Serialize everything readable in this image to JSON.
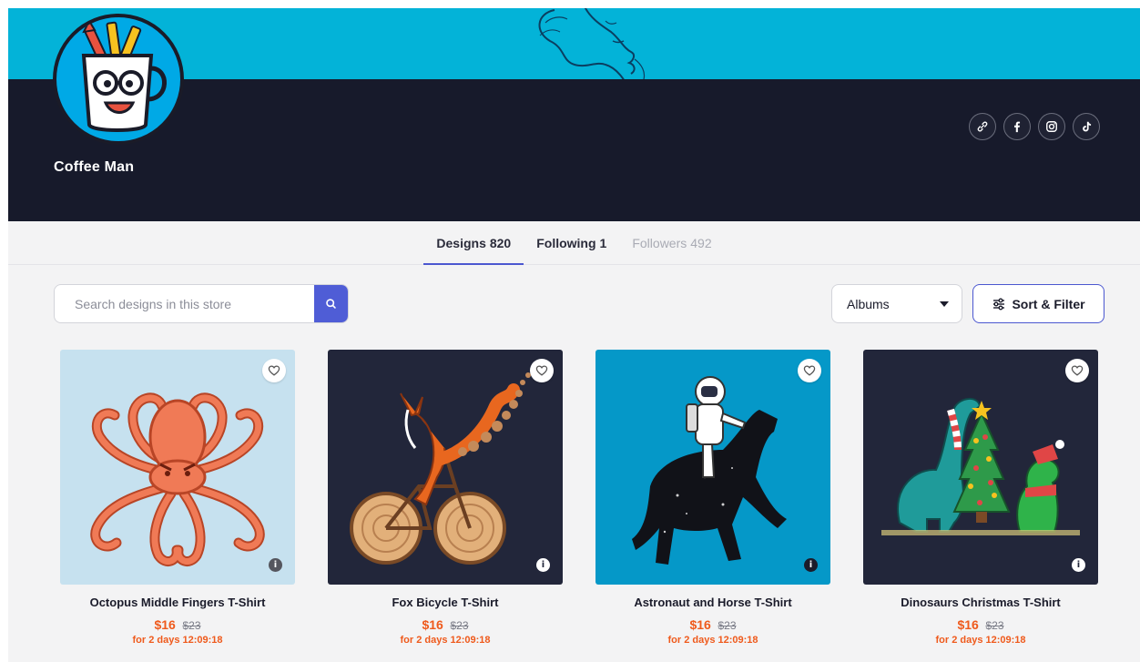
{
  "store": {
    "name": "Coffee Man"
  },
  "social": [
    {
      "name": "link-icon"
    },
    {
      "name": "facebook-icon"
    },
    {
      "name": "instagram-icon"
    },
    {
      "name": "tiktok-icon"
    }
  ],
  "tabs": [
    {
      "label": "Designs",
      "count": "820",
      "active": true
    },
    {
      "label": "Following",
      "count": "1",
      "active": false
    },
    {
      "label": "Followers",
      "count": "492",
      "active": false
    }
  ],
  "search": {
    "placeholder": "Search designs in this store",
    "value": ""
  },
  "albums": {
    "selected": "Albums"
  },
  "sort_filter": {
    "label": "Sort & Filter"
  },
  "products": [
    {
      "title": "Octopus Middle Fingers T-Shirt",
      "price": "$16",
      "was": "$23",
      "timer": "for 2 days 12:09:18",
      "bg": "#c6e1ef"
    },
    {
      "title": "Fox Bicycle T-Shirt",
      "price": "$16",
      "was": "$23",
      "timer": "for 2 days 12:09:18",
      "bg": "#22263a"
    },
    {
      "title": "Astronaut and Horse T-Shirt",
      "price": "$16",
      "was": "$23",
      "timer": "for 2 days 12:09:18",
      "bg": "#0598c8"
    },
    {
      "title": "Dinosaurs Christmas T-Shirt",
      "price": "$16",
      "was": "$23",
      "timer": "for 2 days 12:09:18",
      "bg": "#22263a"
    }
  ],
  "colors": {
    "banner_top": "#03b3d8",
    "banner_bottom": "#171a2b",
    "accent": "#4b57d0",
    "price": "#ef5a1c"
  }
}
